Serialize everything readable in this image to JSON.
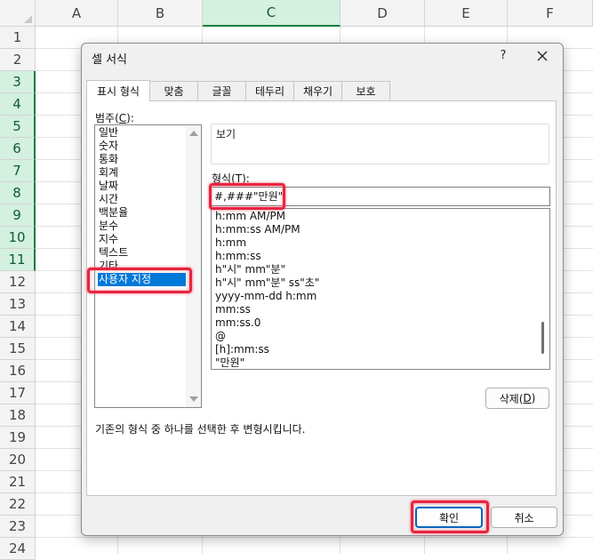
{
  "sheet": {
    "columns": [
      "A",
      "B",
      "C",
      "D",
      "E",
      "F"
    ],
    "selected_column": "C",
    "rows": [
      "1",
      "2",
      "3",
      "4",
      "5",
      "6",
      "7",
      "8",
      "9",
      "10",
      "11",
      "12",
      "13",
      "14",
      "15",
      "16",
      "17",
      "18",
      "19",
      "20",
      "21",
      "22",
      "23",
      "24"
    ],
    "selected_rows": [
      "3",
      "4",
      "5",
      "6",
      "7",
      "8",
      "9",
      "10",
      "11"
    ]
  },
  "dialog": {
    "title": "셀 서식",
    "help_label": "?",
    "tabs": [
      "표시 형식",
      "맞춤",
      "글꼴",
      "테두리",
      "채우기",
      "보호"
    ],
    "active_tab": "표시 형식",
    "category_label_prefix": "범주(",
    "category_label_key": "C",
    "category_label_suffix": "):",
    "categories": [
      "일반",
      "숫자",
      "통화",
      "회계",
      "날짜",
      "시간",
      "백분율",
      "분수",
      "지수",
      "텍스트",
      "기타",
      "사용자 지정"
    ],
    "selected_category": "사용자 지정",
    "sample_label": "보기",
    "type_label_prefix": "형식(",
    "type_label_key": "T",
    "type_label_suffix": "):",
    "type_value": "#,###\"만원\"",
    "format_list": [
      "h:mm AM/PM",
      "h:mm:ss AM/PM",
      "h:mm",
      "h:mm:ss",
      "h\"시\" mm\"분\"",
      "h\"시\" mm\"분\" ss\"초\"",
      "yyyy-mm-dd h:mm",
      "mm:ss",
      "mm:ss.0",
      "@",
      "[h]:mm:ss",
      "\"만원\""
    ],
    "delete_label_prefix": "삭제(",
    "delete_label_key": "D",
    "delete_label_suffix": ")",
    "description": "기존의 형식 중 하나를 선택한 후 변형시킵니다.",
    "ok_label": "확인",
    "cancel_label": "취소"
  },
  "colors": {
    "accent": "#0078d7",
    "highlight": "#e8243f",
    "excel_green": "#107c41"
  }
}
